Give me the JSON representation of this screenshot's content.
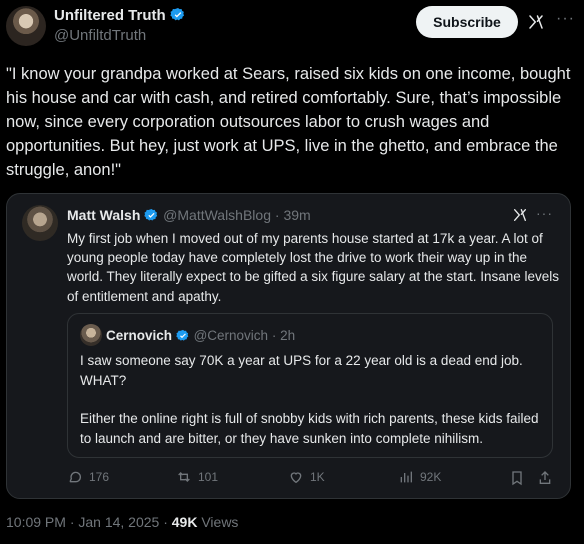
{
  "author": {
    "name": "Unfiltered Truth",
    "handle": "@UnfiltdTruth"
  },
  "subscribe_label": "Subscribe",
  "tweet_text": "\"I know your grandpa worked at Sears, raised six kids on one income, bought his house and car with cash, and retired comfortably. Sure, that’s impossible now, since every corporation outsources labor to crush wages and opportunities. But hey, just work at UPS, live in the ghetto, and embrace the struggle, anon!\"",
  "quoted": {
    "name": "Matt Walsh",
    "handle": "@MattWalshBlog",
    "time": "39m",
    "text": "My first job when I moved out of my parents house started at 17k a year. A lot of young people today have completely lost the drive to work their way up in the world. They literally expect to be gifted a six figure salary at the start. Insane levels of entitlement and apathy.",
    "inner": {
      "name": "Cernovich",
      "handle": "@Cernovich",
      "time": "2h",
      "text_1": "I saw someone say 70K a year at UPS for a 22 year old is a dead end job. WHAT?",
      "text_2": "Either the online right is full of snobby kids with rich parents, these kids failed to launch and are bitter, or they have sunken into complete nihilism."
    },
    "actions": {
      "replies": "176",
      "reposts": "101",
      "likes": "1K",
      "views": "92K"
    }
  },
  "footer": {
    "time": "10:09 PM · Jan 14, 2025 · ",
    "views": "49K",
    "views_label": " Views"
  },
  "colors": {
    "background": "#000000",
    "text": "#e7e9ea",
    "muted": "#71767b",
    "verified": "#1d9bf0",
    "border": "#2f3336"
  },
  "icons": [
    "verified-badge-icon",
    "grok-icon",
    "more-dots-icon",
    "reply-icon",
    "repost-icon",
    "like-icon",
    "views-icon",
    "bookmark-icon",
    "share-icon"
  ]
}
